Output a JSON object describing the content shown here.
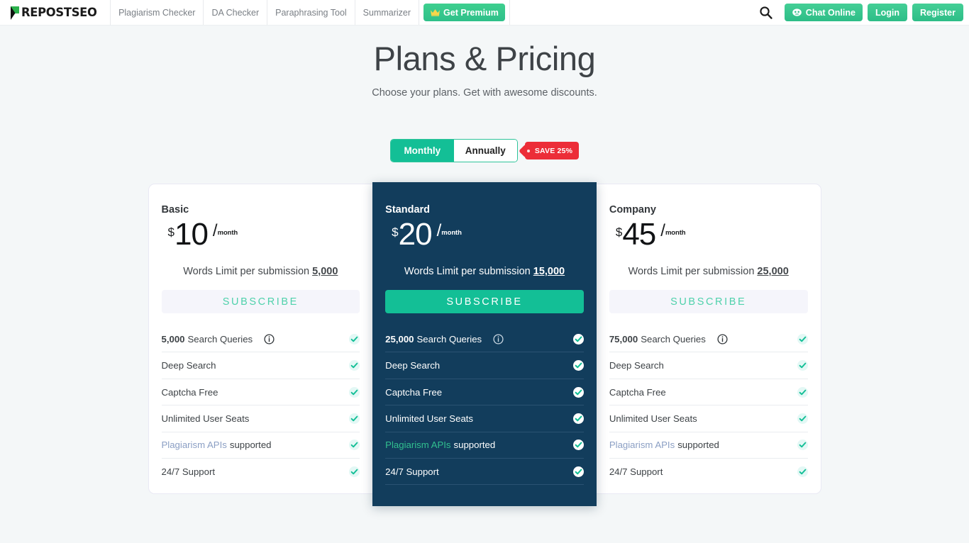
{
  "brand": {
    "logo_text": "REPOSTSEO",
    "logo_icon": "repostseo-p-mark"
  },
  "nav": {
    "links": [
      {
        "label": "Plagiarism Checker"
      },
      {
        "label": "DA Checker"
      },
      {
        "label": "Paraphrasing Tool"
      },
      {
        "label": "Summarizer"
      }
    ],
    "premium_label": "Get Premium",
    "premium_icon": "crown-icon",
    "search_icon": "search-icon",
    "chat_label": "Chat Online",
    "chat_icon": "chat-bot-icon",
    "login_label": "Login",
    "register_label": "Register"
  },
  "hero": {
    "title": "Plans & Pricing",
    "subtitle": "Choose your plans. Get with awesome discounts."
  },
  "billing_toggle": {
    "monthly_label": "Monthly",
    "annually_label": "Annually",
    "active": "Monthly",
    "save_badge": "SAVE 25%"
  },
  "colors": {
    "page_background": "#f4f7f8",
    "brand_green": "#13bf96",
    "featured_card": "#123d5c",
    "save_badge_red": "#ec2d38",
    "subscribe_light_bg": "#f5f5fb",
    "subscribe_light_text": "#4fd1ab",
    "api_link_light": "#8b9fc4",
    "api_link_dark": "#31c08f"
  },
  "plans": [
    {
      "name": "Basic",
      "currency": "$",
      "amount": "10",
      "per_slash": "/",
      "per_unit": "month",
      "words_limit_prefix": "Words Limit per submission ",
      "words_limit_value": "5,000",
      "cta_label": "SUBSCRIBE",
      "featured": false,
      "features": [
        {
          "value": "5,000",
          "label": " Search Queries",
          "info": true,
          "checked": true
        },
        {
          "value": "",
          "label": "Deep Search",
          "info": false,
          "checked": true
        },
        {
          "value": "",
          "label": "Captcha Free",
          "info": false,
          "checked": true
        },
        {
          "value": "",
          "label": "Unlimited User Seats",
          "info": false,
          "checked": true
        },
        {
          "value": "",
          "link": "Plagiarism APIs",
          "label": " supported",
          "info": false,
          "checked": true
        },
        {
          "value": "",
          "label": "24/7 Support",
          "info": false,
          "checked": true
        }
      ]
    },
    {
      "name": "Standard",
      "currency": "$",
      "amount": "20",
      "per_slash": "/",
      "per_unit": "month",
      "words_limit_prefix": "Words Limit per submission ",
      "words_limit_value": "15,000",
      "cta_label": "SUBSCRIBE",
      "featured": true,
      "features": [
        {
          "value": "25,000",
          "label": " Search Queries",
          "info": true,
          "checked": true
        },
        {
          "value": "",
          "label": "Deep Search",
          "info": false,
          "checked": true
        },
        {
          "value": "",
          "label": "Captcha Free",
          "info": false,
          "checked": true
        },
        {
          "value": "",
          "label": "Unlimited User Seats",
          "info": false,
          "checked": true
        },
        {
          "value": "",
          "link": "Plagiarism APIs",
          "label": " supported",
          "info": false,
          "checked": true
        },
        {
          "value": "",
          "label": "24/7 Support",
          "info": false,
          "checked": true
        }
      ]
    },
    {
      "name": "Company",
      "currency": "$",
      "amount": "45",
      "per_slash": "/",
      "per_unit": "month",
      "words_limit_prefix": "Words Limit per submission ",
      "words_limit_value": "25,000",
      "cta_label": "SUBSCRIBE",
      "featured": false,
      "features": [
        {
          "value": "75,000",
          "label": " Search Queries",
          "info": true,
          "checked": true
        },
        {
          "value": "",
          "label": "Deep Search",
          "info": false,
          "checked": true
        },
        {
          "value": "",
          "label": "Captcha Free",
          "info": false,
          "checked": true
        },
        {
          "value": "",
          "label": "Unlimited User Seats",
          "info": false,
          "checked": true
        },
        {
          "value": "",
          "link": "Plagiarism APIs",
          "label": " supported",
          "info": false,
          "checked": true
        },
        {
          "value": "",
          "label": "24/7 Support",
          "info": false,
          "checked": true
        }
      ]
    }
  ]
}
